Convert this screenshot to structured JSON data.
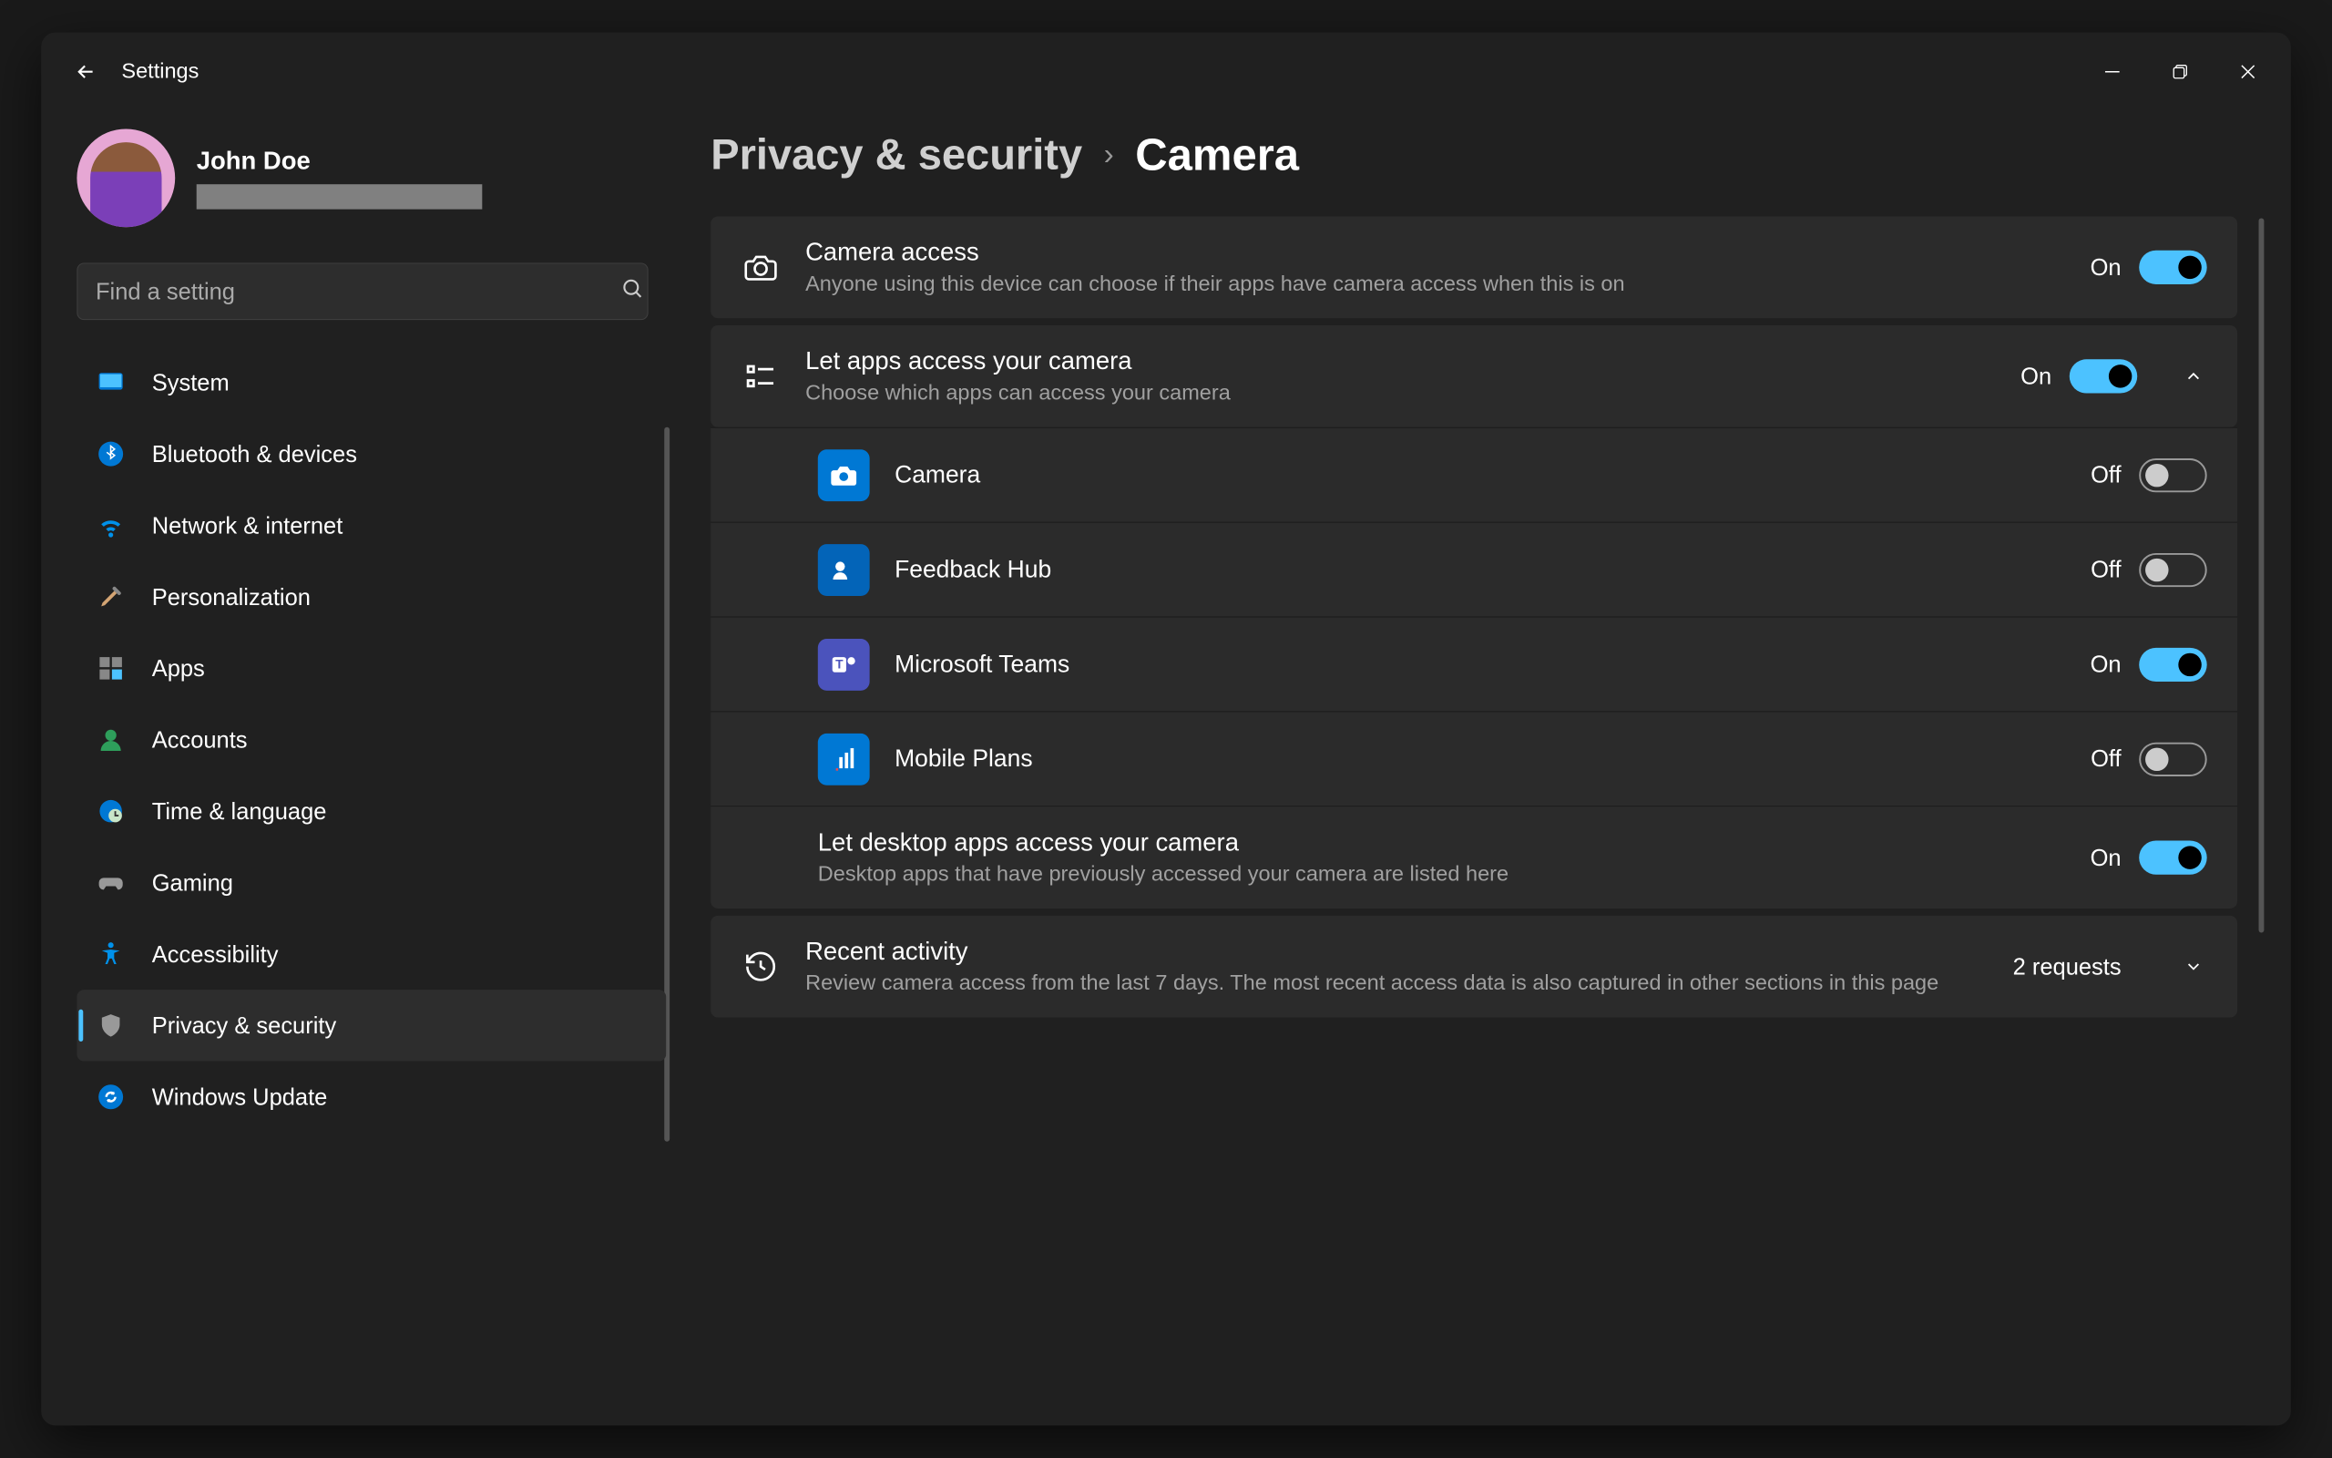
{
  "titlebar": {
    "title": "Settings"
  },
  "profile": {
    "name": "John Doe"
  },
  "search": {
    "placeholder": "Find a setting"
  },
  "sidebar": {
    "items": [
      {
        "label": "System"
      },
      {
        "label": "Bluetooth & devices"
      },
      {
        "label": "Network & internet"
      },
      {
        "label": "Personalization"
      },
      {
        "label": "Apps"
      },
      {
        "label": "Accounts"
      },
      {
        "label": "Time & language"
      },
      {
        "label": "Gaming"
      },
      {
        "label": "Accessibility"
      },
      {
        "label": "Privacy & security"
      },
      {
        "label": "Windows Update"
      }
    ]
  },
  "breadcrumb": {
    "parent": "Privacy & security",
    "current": "Camera"
  },
  "settings": {
    "camera_access": {
      "title": "Camera access",
      "sub": "Anyone using this device can choose if their apps have camera access when this is on",
      "state_label": "On",
      "on": true
    },
    "let_apps": {
      "title": "Let apps access your camera",
      "sub": "Choose which apps can access your camera",
      "state_label": "On",
      "on": true
    },
    "apps": [
      {
        "name": "Camera",
        "state_label": "Off",
        "on": false,
        "icon_bg": "#0078d4"
      },
      {
        "name": "Feedback Hub",
        "state_label": "Off",
        "on": false,
        "icon_bg": "#0364b8"
      },
      {
        "name": "Microsoft Teams",
        "state_label": "On",
        "on": true,
        "icon_bg": "#4b53bc"
      },
      {
        "name": "Mobile Plans",
        "state_label": "Off",
        "on": false,
        "icon_bg": "#0078d4"
      }
    ],
    "desktop_apps": {
      "title": "Let desktop apps access your camera",
      "sub": "Desktop apps that have previously accessed your camera are listed here",
      "state_label": "On",
      "on": true
    },
    "recent": {
      "title": "Recent activity",
      "sub": "Review camera access from the last 7 days. The most recent access data is also captured in other sections in this page",
      "count": "2 requests"
    }
  }
}
